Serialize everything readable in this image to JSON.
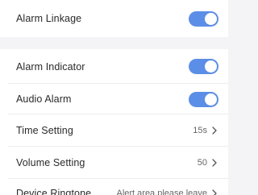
{
  "settings": {
    "alarm_linkage": {
      "label": "Alarm Linkage",
      "enabled": true
    },
    "alarm_indicator": {
      "label": "Alarm Indicator",
      "enabled": true
    },
    "audio_alarm": {
      "label": "Audio Alarm",
      "enabled": true
    },
    "time_setting": {
      "label": "Time Setting",
      "value": "15s"
    },
    "volume_setting": {
      "label": "Volume Setting",
      "value": "50"
    },
    "device_ringtone": {
      "label": "Device Ringtone",
      "value": "Alert area,please leave"
    }
  },
  "colors": {
    "toggle_on": "#5b8ee6",
    "background": "#f4f4f6"
  },
  "icons": {
    "chevron": "chevron-right-icon"
  }
}
